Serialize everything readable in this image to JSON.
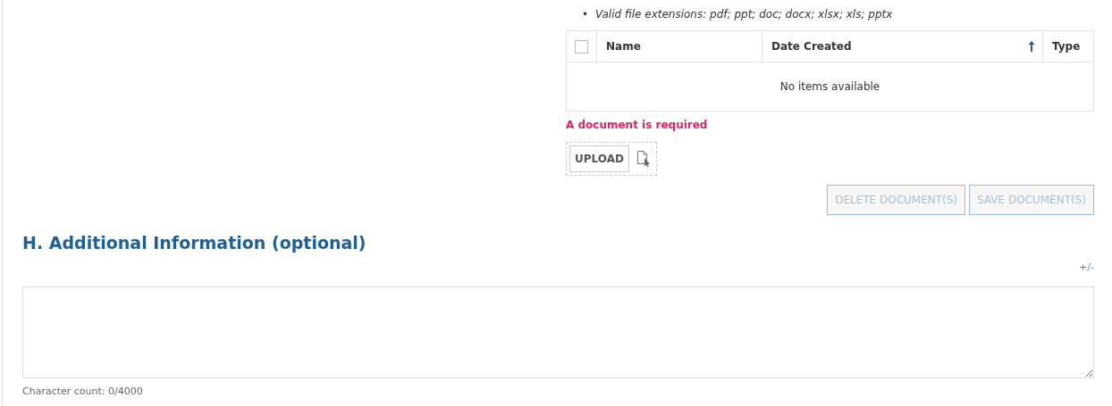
{
  "upload_section": {
    "notes": [
      {
        "marker": "•",
        "text": "Valid file extensions: pdf; ppt; doc; docx; xlsx; xls; pptx"
      }
    ],
    "table": {
      "select_all": {
        "checked": false
      },
      "columns": [
        {
          "label": "Name",
          "sorted": false
        },
        {
          "label": "Date Created",
          "sorted": true
        },
        {
          "label": "Type",
          "sorted": false
        }
      ],
      "empty_message": "No items available"
    },
    "error": "A document is required",
    "upload_button": "UPLOAD",
    "buttons": [
      {
        "label": "DELETE DOCUMENT(S)",
        "disabled": true
      },
      {
        "label": "SAVE DOCUMENT(S)",
        "disabled": true
      }
    ]
  },
  "additional_info": {
    "heading": "H. Additional Information (optional)",
    "toggle": "+/-",
    "character_count": "Character count: 0/4000"
  }
}
